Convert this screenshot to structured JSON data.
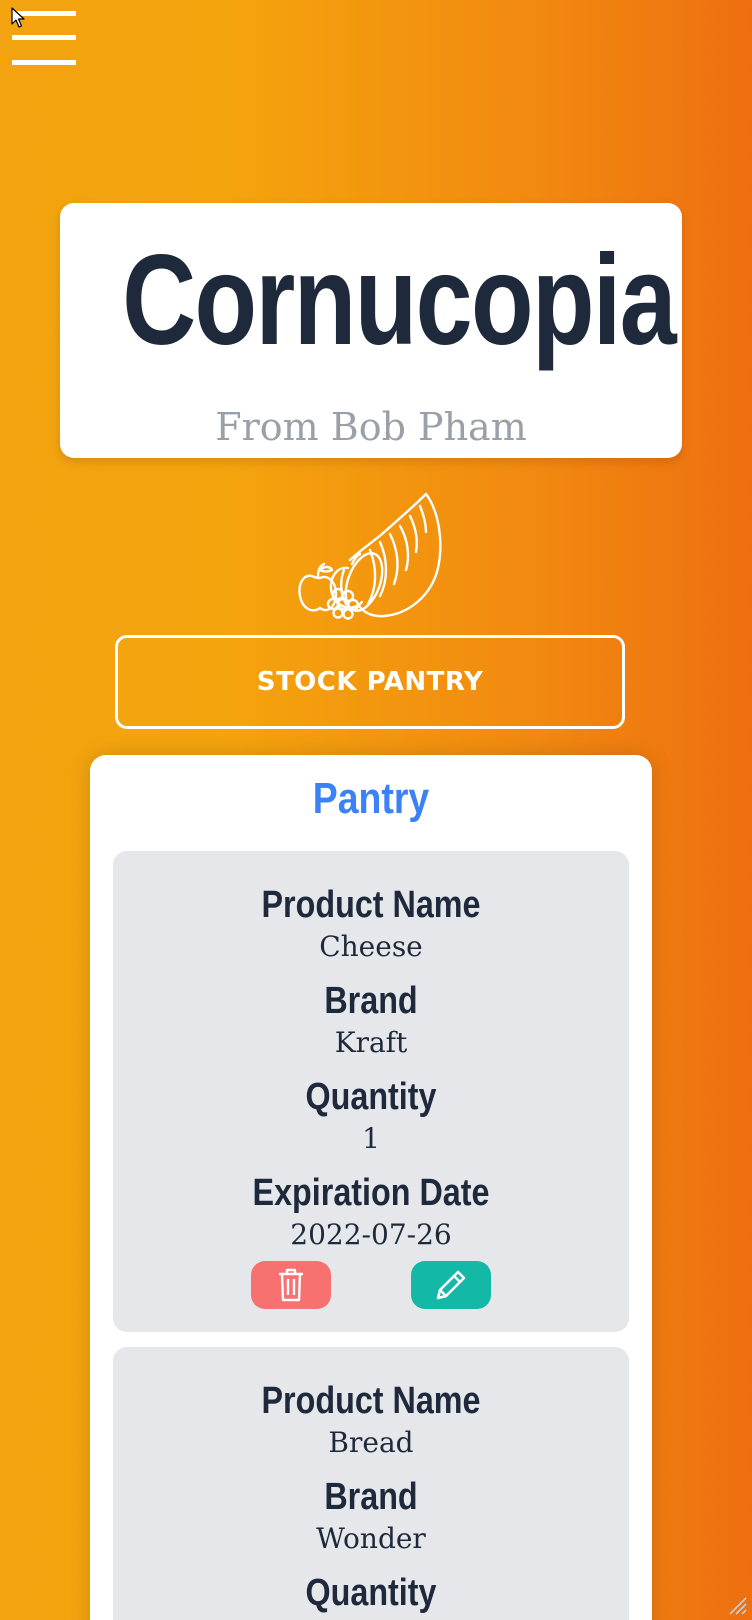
{
  "header": {
    "menu_icon": "hamburger-menu-icon"
  },
  "hero": {
    "title": "Cornucopia",
    "subtitle": "From Bob Pham",
    "logo_icon": "cornucopia-icon"
  },
  "actions": {
    "stock_pantry_label": "STOCK PANTRY"
  },
  "pantry": {
    "title": "Pantry",
    "labels": {
      "product_name": "Product Name",
      "brand": "Brand",
      "quantity": "Quantity",
      "expiration_date": "Expiration Date"
    },
    "items": [
      {
        "product_name": "Cheese",
        "brand": "Kraft",
        "quantity": "1",
        "expiration_date": "2022-07-26",
        "delete_icon": "trash-icon",
        "edit_icon": "pencil-icon"
      },
      {
        "product_name": "Bread",
        "brand": "Wonder"
      }
    ]
  },
  "colors": {
    "gradient_start": "#f4a40d",
    "gradient_end": "#ee6f10",
    "title_text": "#1e293b",
    "subtitle_text": "#9aa0a8",
    "pantry_title": "#3b82f6",
    "card_bg": "#e5e7eb",
    "delete_button": "#f87171",
    "edit_button": "#14b8a6"
  }
}
